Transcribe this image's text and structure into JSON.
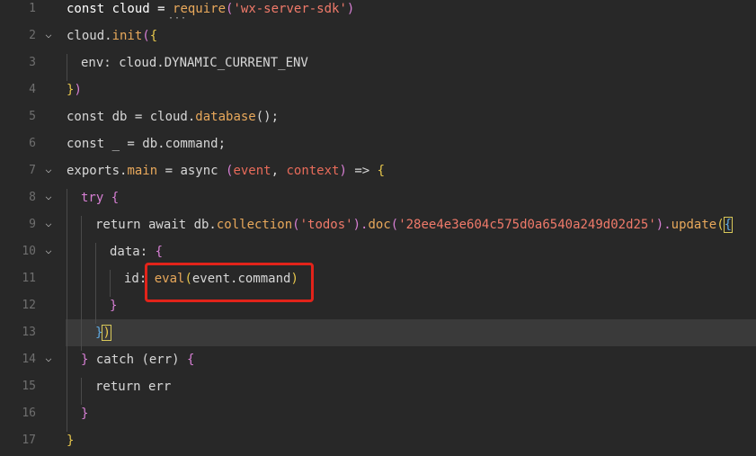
{
  "editor": {
    "line_numbers": [
      "1",
      "2",
      "3",
      "4",
      "5",
      "6",
      "7",
      "8",
      "9",
      "10",
      "11",
      "12",
      "13",
      "14",
      "15",
      "16",
      "17"
    ],
    "lines": {
      "l1": [
        "const cloud = ",
        "require",
        "(",
        "'wx-server-sdk'",
        ")"
      ],
      "l2": [
        "cloud.",
        "init",
        "(",
        "{"
      ],
      "l3": [
        "env: cloud.DYNAMIC_CURRENT_ENV"
      ],
      "l4": [
        "}",
        ")"
      ],
      "l5": [
        "const db = cloud.",
        "database",
        "();"
      ],
      "l6": [
        "const _ = db.command;"
      ],
      "l7": [
        "exports.",
        "main",
        " = async ",
        "(",
        "event",
        ", ",
        "context",
        ")",
        " => ",
        "{"
      ],
      "l8": [
        "try ",
        "{"
      ],
      "l9": [
        "return await db.",
        "collection",
        "(",
        "'todos'",
        ").",
        "doc",
        "(",
        "'28ee4e3e604c575d0a6540a249d02d25'",
        ").",
        "update",
        "(",
        "{"
      ],
      "l10": [
        "data: ",
        "{"
      ],
      "l11": [
        "id: ",
        "eval",
        "(",
        "event.command",
        ")"
      ],
      "l12": [
        "}"
      ],
      "l13": [
        "}",
        ")"
      ],
      "l14": [
        "} ",
        "catch ",
        "(err) ",
        "{"
      ],
      "l15": [
        "return err"
      ],
      "l16": [
        "}"
      ],
      "l17": [
        "}"
      ]
    },
    "hover_dots": "···",
    "highlighted_line": "13"
  }
}
